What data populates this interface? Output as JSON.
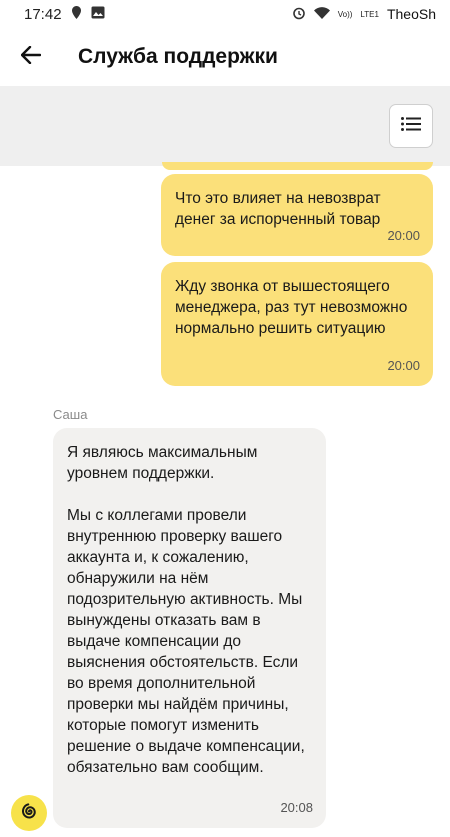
{
  "status_bar": {
    "time": "17:42",
    "watermark": "TheoSh",
    "network": "LTE1",
    "volte": "Vo))"
  },
  "header": {
    "title": "Служба поддержки",
    "icons": {
      "back": "arrow-left-icon",
      "menu": "list-icon"
    }
  },
  "messages": [
    {
      "direction": "out",
      "text": "Что это влияет на невозврат денег за испорченный товар",
      "time": "20:00"
    },
    {
      "direction": "out",
      "text": "Жду звонка от вышестоящего менеджера, раз тут невозможно нормально решить ситуацию",
      "time": "20:00"
    },
    {
      "direction": "in",
      "sender": "Саша",
      "paragraph1": "Я являюсь максимальным уровнем поддержки.",
      "paragraph2": "Мы с коллегами провели внутреннюю проверку вашего аккаунта и, к сожалению, обнаружили на нём подозрительную активность. Мы вынуждены отказать вам в выдаче компенсации до выяснения обстоятельств. Если во время дополнительной проверки мы найдём причины, которые помогут изменить решение о выдаче компенсации, обязательно вам сообщим.",
      "time": "20:08"
    }
  ],
  "colors": {
    "outgoing": "#fbe07a",
    "incoming": "#f2f1ef",
    "toolbar": "#efefef"
  }
}
